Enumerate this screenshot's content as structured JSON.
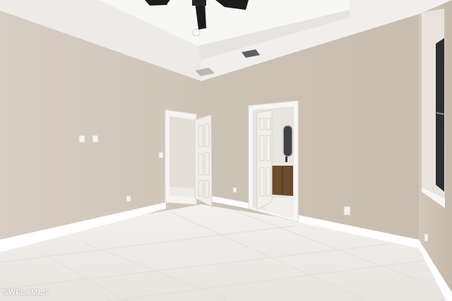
{
  "photo": {
    "subject": "empty-bedroom-interior",
    "watermark": "SWFLAMLS"
  },
  "colors": {
    "wall": "#cfc4b8",
    "wall_shadow": "#c2b6a9",
    "ceiling": "#f2f1ef",
    "floor": "#eceae6",
    "baseboard": "#ffffff",
    "door": "#efece8",
    "vanity": "#6b4a2e",
    "window_frame": "#2d2f33"
  },
  "icons": {
    "ceiling_fan": "ceiling-fan-icon",
    "recessed_light": "recessed-light-icon"
  }
}
